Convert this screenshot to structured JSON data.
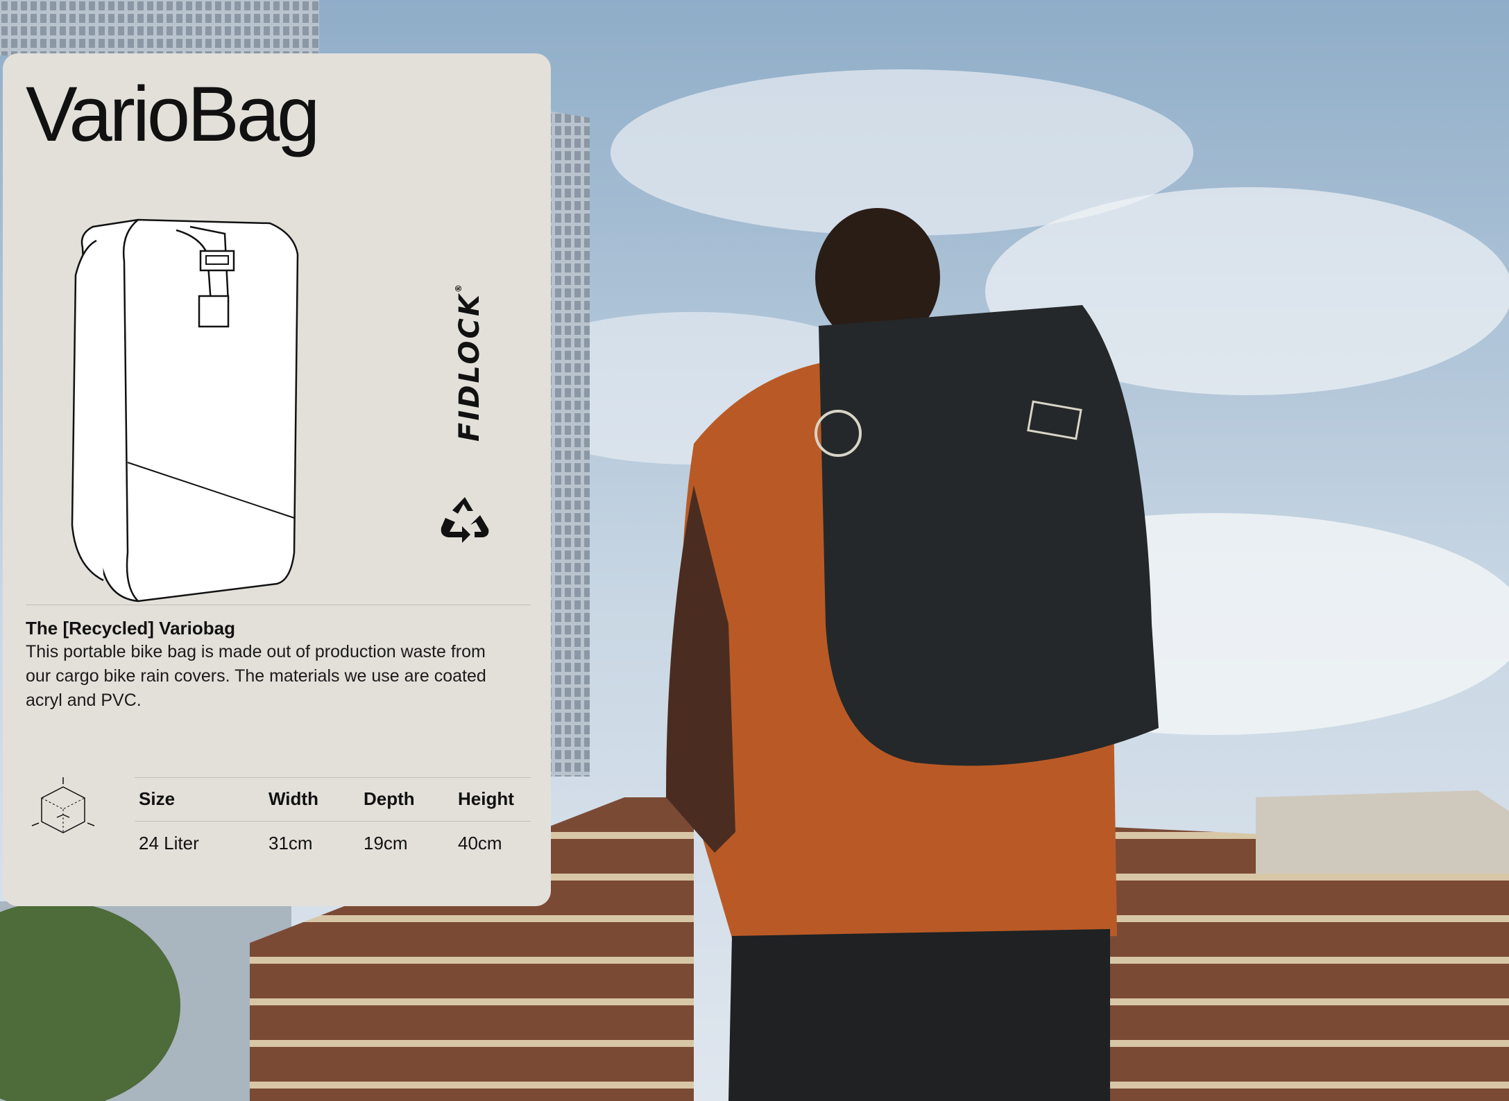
{
  "card": {
    "title": "VarioBag",
    "brand_logo": "FIDLOCK",
    "icons": [
      "bag-illustration",
      "recycle-icon",
      "dimensions-cube-icon"
    ],
    "description_heading": "The [Recycled] Variobag",
    "description_body": "This portable bike bag is made out of production waste from our cargo bike rain covers. The materials we use are coated acryl and PVC."
  },
  "specs": {
    "headers": {
      "size": "Size",
      "width": "Width",
      "depth": "Depth",
      "height": "Height"
    },
    "row": {
      "size": "24 Liter",
      "width": "31cm",
      "depth": "19cm",
      "height": "40cm"
    }
  },
  "colors": {
    "card_bg": "#e3e0da",
    "shirt": "#b95a26",
    "bag": "#24282a",
    "brick": "#7a4a34"
  }
}
